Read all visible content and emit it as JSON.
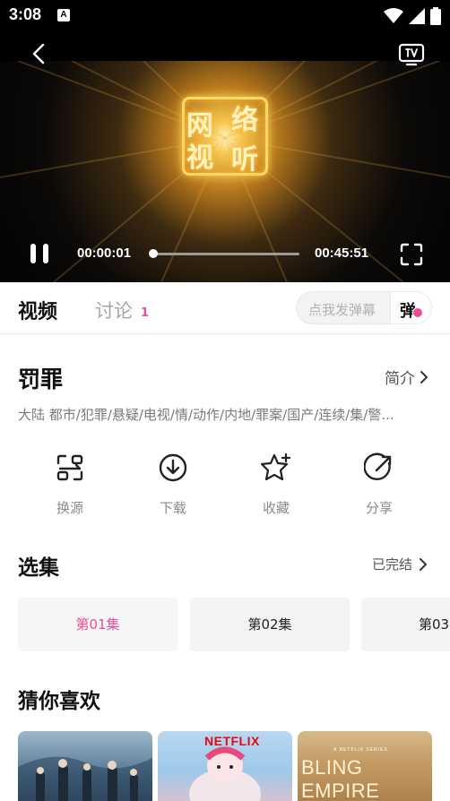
{
  "status_bar": {
    "time": "3:08",
    "notification_glyph": "A"
  },
  "player": {
    "current_time": "00:00:01",
    "total_time": "00:45:51",
    "progress_fraction": 0.0004,
    "logo_chars": [
      "网",
      "络",
      "视",
      "听"
    ]
  },
  "tabs": {
    "video": "视频",
    "discuss": "讨论",
    "discuss_count": "1",
    "danmu_placeholder": "点我发弹幕",
    "danmu_toggle": "弹"
  },
  "info": {
    "title": "罚罪",
    "intro_label": "简介",
    "tags": "大陆  都市/犯罪/悬疑/电视/情/动作/内地/罪案/国产/连续/集/警..."
  },
  "actions": [
    {
      "label": "换源",
      "icon": "switch-source-icon"
    },
    {
      "label": "下载",
      "icon": "download-icon"
    },
    {
      "label": "收藏",
      "icon": "star-plus-icon"
    },
    {
      "label": "分享",
      "icon": "share-icon"
    }
  ],
  "episodes": {
    "heading": "选集",
    "status": "已完结",
    "items": [
      "第01集",
      "第02集",
      "第03"
    ]
  },
  "recommend": {
    "heading": "猜你喜欢",
    "items": [
      {
        "overlay": ""
      },
      {
        "overlay": "NETFLIX"
      },
      {
        "overlay": "BLING EMPIRE",
        "subtitle": "A NETFLIX SERIES"
      }
    ]
  },
  "colors": {
    "accent": "#ec4a9a",
    "player_bg": "#000000",
    "logo_gold": "#ffd86a"
  }
}
